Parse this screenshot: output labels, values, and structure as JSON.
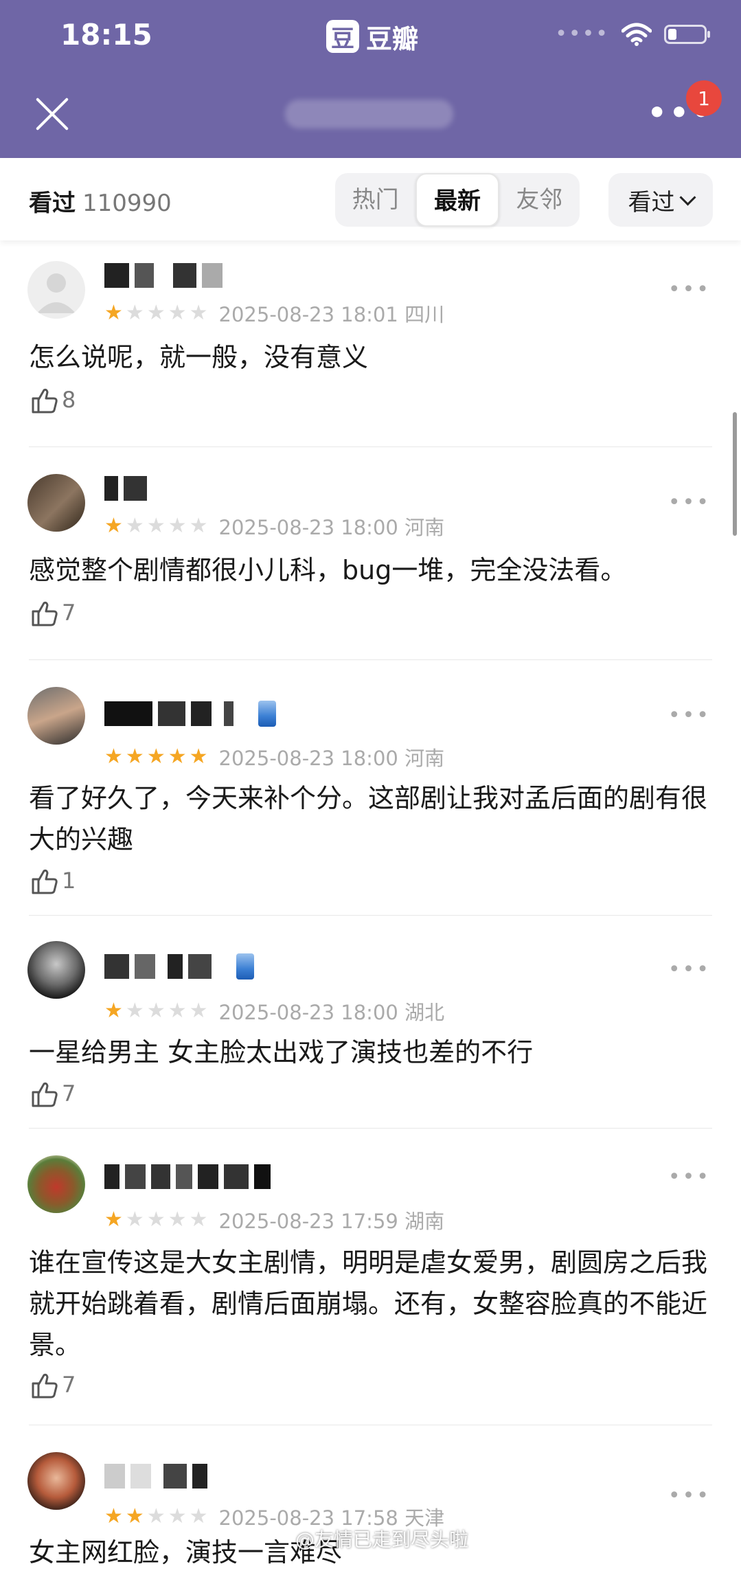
{
  "status_bar": {
    "time": "18:15"
  },
  "app": {
    "logo_char": "豆",
    "name": "豆瓣"
  },
  "header": {
    "notification_count": "1"
  },
  "filter": {
    "watched_label": "看过",
    "watched_count": "110990",
    "tabs": [
      {
        "label": "热门",
        "active": false
      },
      {
        "label": "最新",
        "active": true
      },
      {
        "label": "友邻",
        "active": false
      }
    ],
    "dropdown_label": "看过"
  },
  "reviews": [
    {
      "rating": 1,
      "datetime": "2025-08-23 18:01 四川",
      "text": "怎么说呢，就一般，没有意义",
      "likes": "8"
    },
    {
      "rating": 1,
      "datetime": "2025-08-23 18:00 河南",
      "text": "感觉整个剧情都很小儿科，bug一堆，完全没法看。",
      "likes": "7"
    },
    {
      "rating": 5,
      "datetime": "2025-08-23 18:00 河南",
      "text": "看了好久了，今天来补个分。这部剧让我对孟后面的剧有很大的兴趣",
      "likes": "1"
    },
    {
      "rating": 1,
      "datetime": "2025-08-23 18:00 湖北",
      "text": "一星给男主  女主脸太出戏了演技也差的不行",
      "likes": "7"
    },
    {
      "rating": 1,
      "datetime": "2025-08-23 17:59 湖南",
      "text": "谁在宣传这是大女主剧情，明明是虐女爱男，剧圆房之后我就开始跳着看，剧情后面崩塌。还有，女整容脸真的不能近景。",
      "likes": "7"
    },
    {
      "rating": 2,
      "datetime": "2025-08-23 17:58 天津",
      "text": "女主网红脸，演技一言难尽",
      "likes": ""
    }
  ],
  "watermark": "@友情已走到尽头啦",
  "colors": {
    "header_bg": "#6f66a6",
    "star_on": "#f5a623",
    "star_off": "#dcdcdc",
    "badge": "#e8473d"
  }
}
